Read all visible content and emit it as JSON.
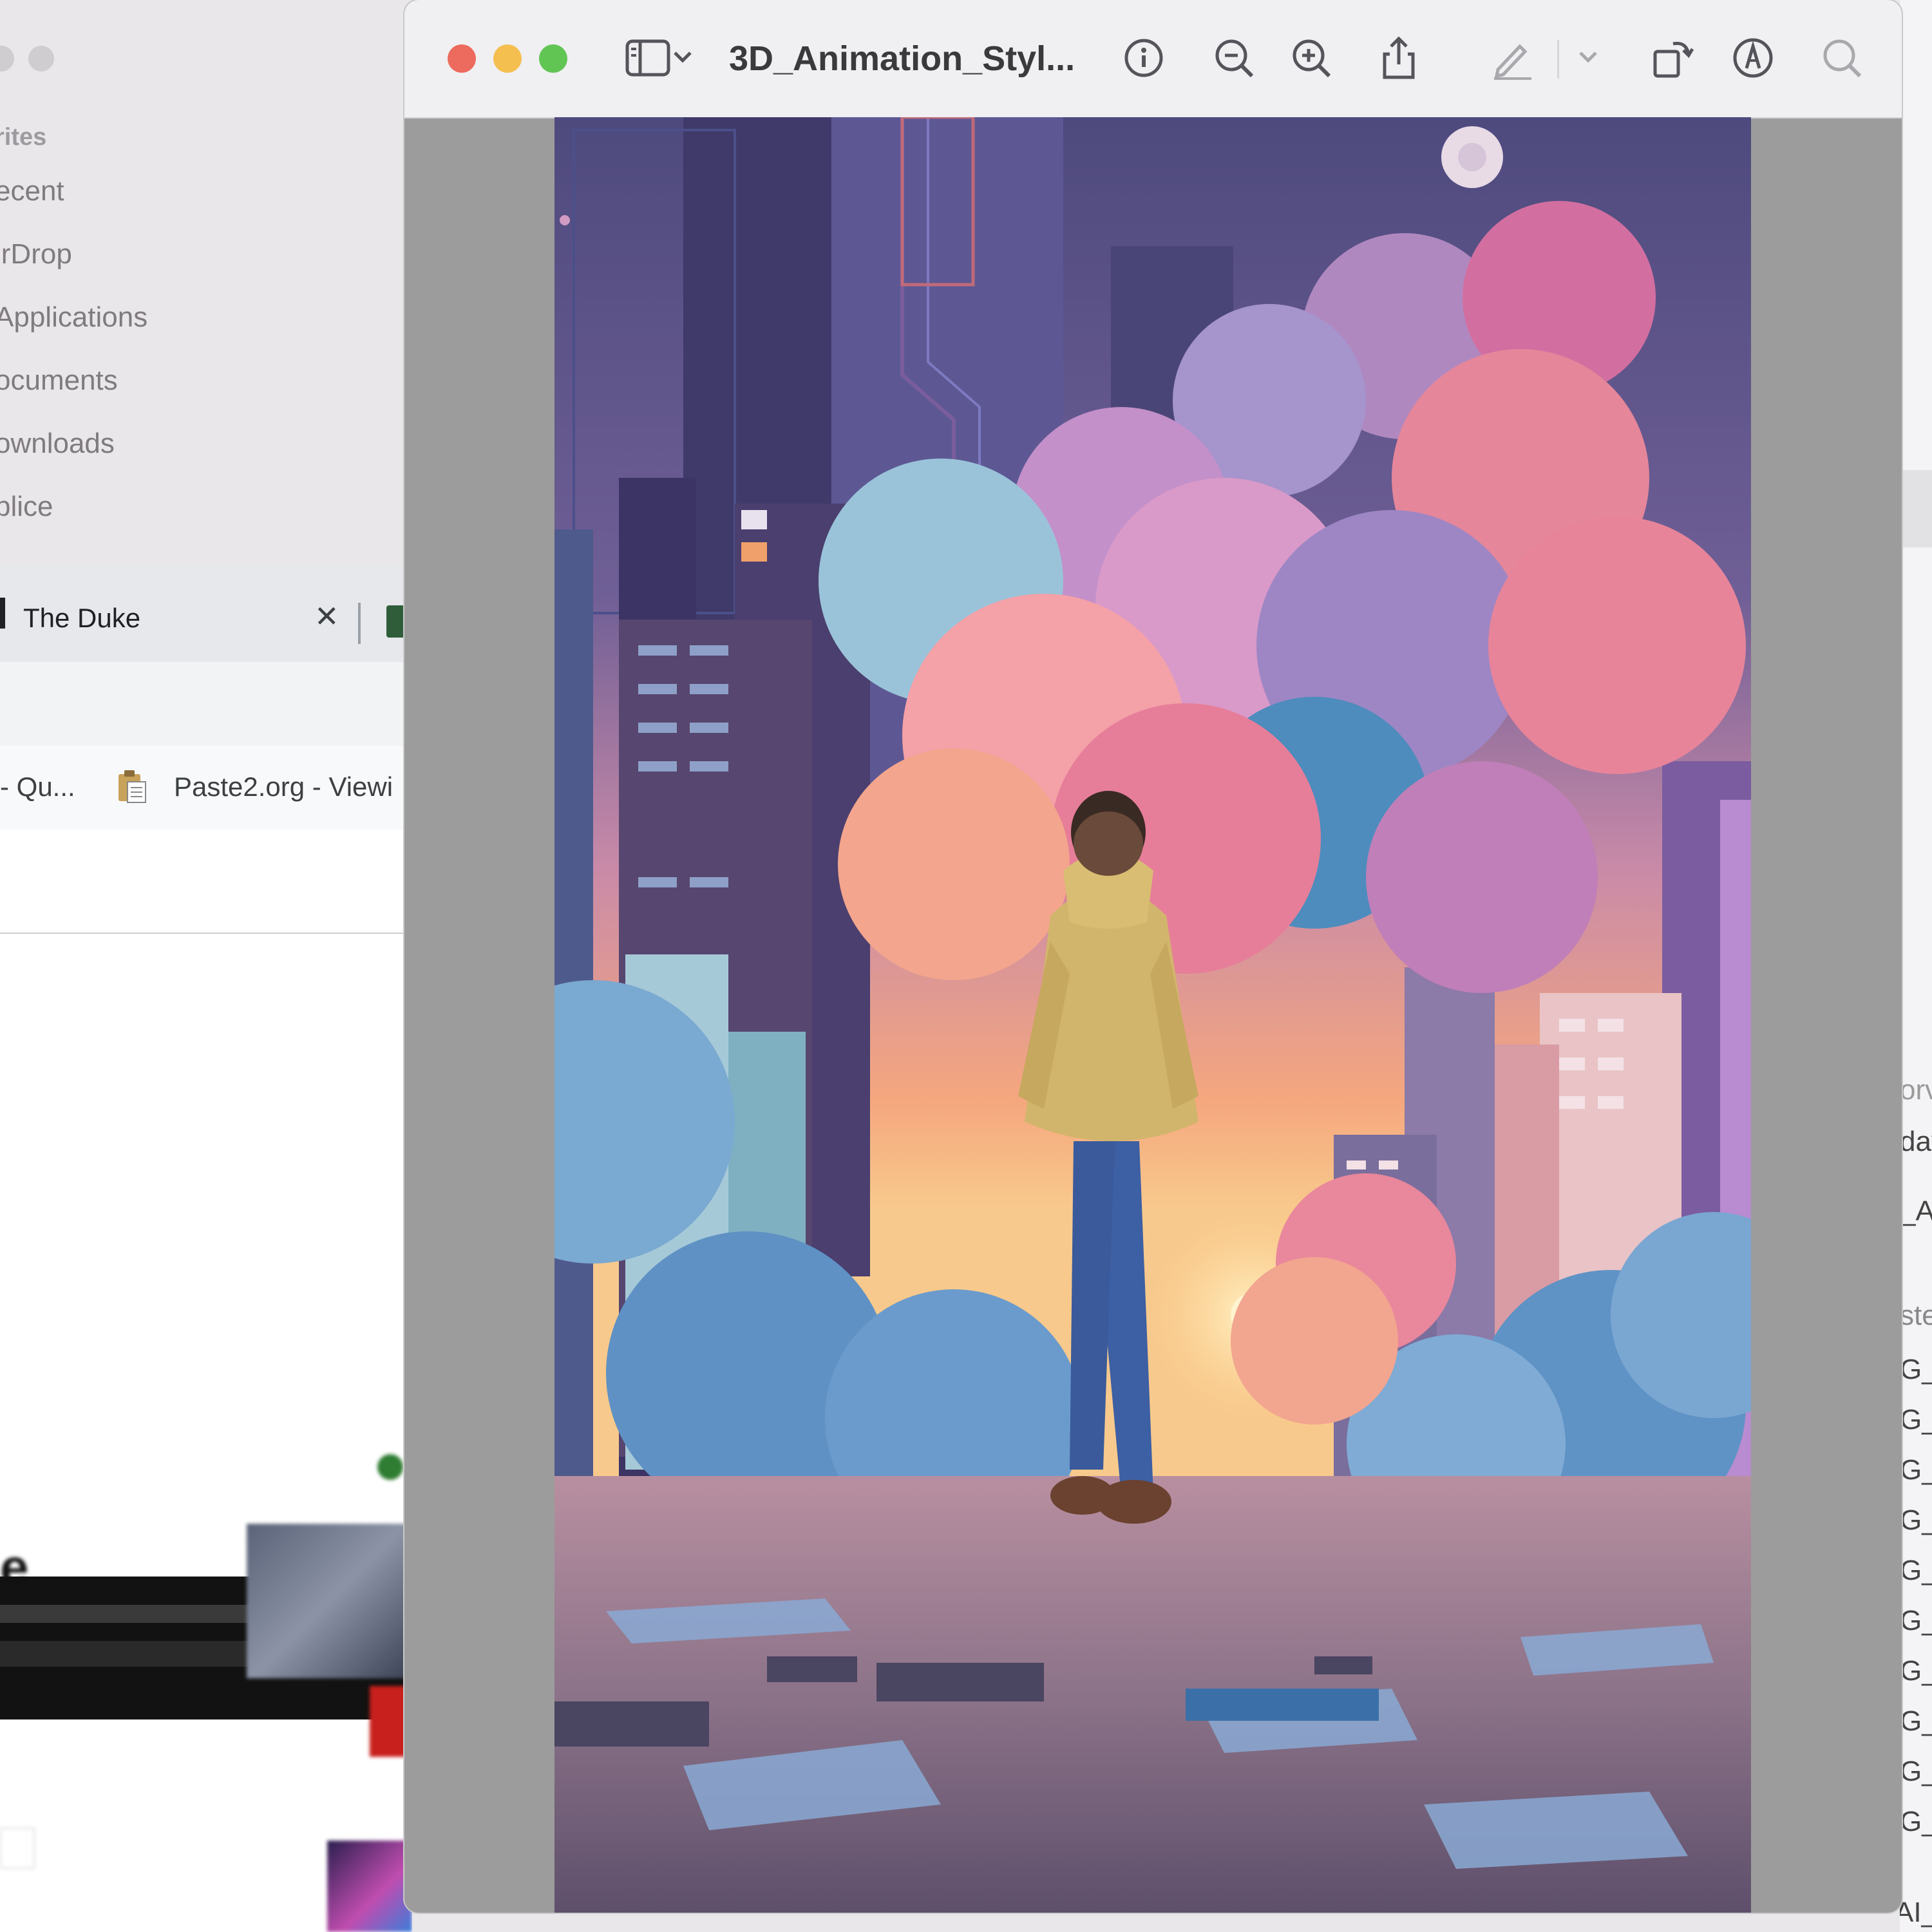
{
  "finder": {
    "sidebar_heading": "rites",
    "sidebar_items": [
      "ecent",
      "irDrop",
      "Applications",
      "ocuments",
      "ownloads",
      "plice"
    ]
  },
  "browser": {
    "tab_title": "The Duke",
    "tab_close": "✕",
    "bookmarks": [
      "- Qu...",
      "Paste2.org - Viewi"
    ]
  },
  "preview": {
    "title": "3D_Animation_Styl...",
    "toolbar_icons": [
      "sidebar-icon",
      "chevron-down-icon",
      "info-icon",
      "zoom-out-icon",
      "zoom-in-icon",
      "share-icon",
      "markup-pencil-icon",
      "chevron-down-icon",
      "rotate-icon",
      "annotate-icon",
      "search-icon"
    ]
  },
  "right_panel": {
    "fragments": [
      "orv",
      "day",
      "_A",
      "ste",
      "G_",
      "G_",
      "G_",
      "G_",
      "G_",
      "G_",
      "G_",
      "G_",
      "G_",
      "G_",
      "AI_Te"
    ]
  },
  "colors": {
    "close": "#ed6a5e",
    "minimize": "#f5bf4f",
    "maximize": "#61c554",
    "sky_top": "#4e4a7e",
    "sunset": "#f5a77e"
  }
}
